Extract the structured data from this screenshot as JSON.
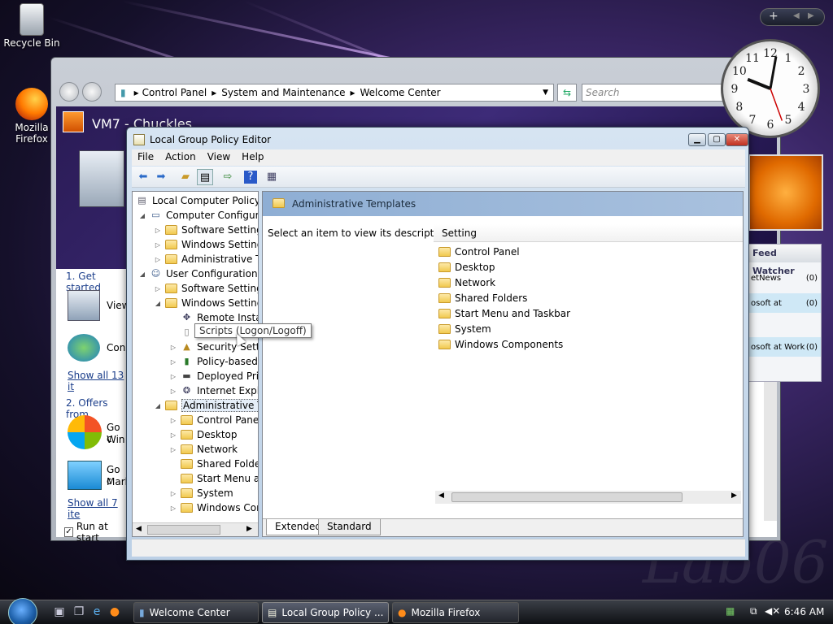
{
  "desktop": {
    "icons": [
      {
        "label": "Recycle Bin"
      },
      {
        "label_line1": "Mozilla",
        "label_line2": "Firefox"
      }
    ],
    "watermark": "Lab06"
  },
  "welcome_center": {
    "breadcrumb": [
      "Control Panel",
      "System and Maintenance",
      "Welcome Center"
    ],
    "search_placeholder": "Search",
    "computer_name": "VM7 - Chuckles",
    "get_started": "1. Get started",
    "view": "View",
    "con": "Con",
    "show_all_13": "Show all 13 it",
    "offers_from": "2. Offers from",
    "go_1": "Go c",
    "win": "Win",
    "go_2": "Go c",
    "mark": "Mark",
    "show_all_7": "Show all 7 ite",
    "run_at_startup": "Run at start"
  },
  "gadgets": {
    "feed_title": "Feed Watcher",
    "feeds": [
      {
        "name": "etNews",
        "count": "(0)"
      },
      {
        "name": "osoft at",
        "count": "(0)"
      },
      {
        "name": "osoft at Work",
        "count": "(0)"
      }
    ],
    "clock_numbers": [
      "12",
      "1",
      "2",
      "3",
      "4",
      "5",
      "6",
      "7",
      "8",
      "9",
      "10",
      "11"
    ]
  },
  "gpo": {
    "title": "Local Group Policy Editor",
    "menu": [
      "File",
      "Action",
      "View",
      "Help"
    ],
    "tree": [
      {
        "label": "Local Computer Policy",
        "level": 0,
        "expander": "",
        "icon": "policy"
      },
      {
        "label": "Computer Configura",
        "level": 1,
        "expander": "◢",
        "icon": "computer"
      },
      {
        "label": "Software Settings",
        "level": 2,
        "expander": "▷",
        "icon": "folder"
      },
      {
        "label": "Windows Setting",
        "level": 2,
        "expander": "▷",
        "icon": "folder"
      },
      {
        "label": "Administrative Te",
        "level": 2,
        "expander": "▷",
        "icon": "folder"
      },
      {
        "label": "User Configuration",
        "level": 1,
        "expander": "◢",
        "icon": "user"
      },
      {
        "label": "Software Settings",
        "level": 2,
        "expander": "▷",
        "icon": "folder"
      },
      {
        "label": "Windows Setting",
        "level": 2,
        "expander": "◢",
        "icon": "folder"
      },
      {
        "label": "Remote Instal",
        "level": 3,
        "expander": "",
        "icon": "remote"
      },
      {
        "label": "Scripts (Logon",
        "level": 3,
        "expander": "",
        "icon": "script"
      },
      {
        "label": "Security Settin",
        "level": 3,
        "expander": "▷",
        "icon": "security"
      },
      {
        "label": "Policy-based",
        "level": 3,
        "expander": "▷",
        "icon": "chart"
      },
      {
        "label": "Deployed Prir",
        "level": 3,
        "expander": "▷",
        "icon": "printer"
      },
      {
        "label": "Internet Explo",
        "level": 3,
        "expander": "▷",
        "icon": "ie"
      },
      {
        "label": "Administrative Te",
        "level": 2,
        "expander": "◢",
        "icon": "folder",
        "selected": true
      },
      {
        "label": "Control Panel",
        "level": 3,
        "expander": "▷",
        "icon": "folder"
      },
      {
        "label": "Desktop",
        "level": 3,
        "expander": "▷",
        "icon": "folder"
      },
      {
        "label": "Network",
        "level": 3,
        "expander": "▷",
        "icon": "folder"
      },
      {
        "label": "Shared Folder",
        "level": 3,
        "expander": "",
        "icon": "folder"
      },
      {
        "label": "Start Menu ar",
        "level": 3,
        "expander": "",
        "icon": "folder"
      },
      {
        "label": "System",
        "level": 3,
        "expander": "▷",
        "icon": "folder"
      },
      {
        "label": "Windows Cor",
        "level": 3,
        "expander": "▷",
        "icon": "folder"
      }
    ],
    "right_header": "Administrative Templates",
    "description": "Select an item to view its description.",
    "column_header": "Setting",
    "items": [
      "Control Panel",
      "Desktop",
      "Network",
      "Shared Folders",
      "Start Menu and Taskbar",
      "System",
      "Windows Components"
    ],
    "tabs": [
      "Extended",
      "Standard"
    ],
    "tooltip": "Scripts (Logon/Logoff)"
  },
  "taskbar": {
    "tasks": [
      {
        "label": "Welcome Center"
      },
      {
        "label": "Local Group Policy ..."
      },
      {
        "label": "Mozilla Firefox"
      }
    ],
    "time": "6:46 AM"
  }
}
